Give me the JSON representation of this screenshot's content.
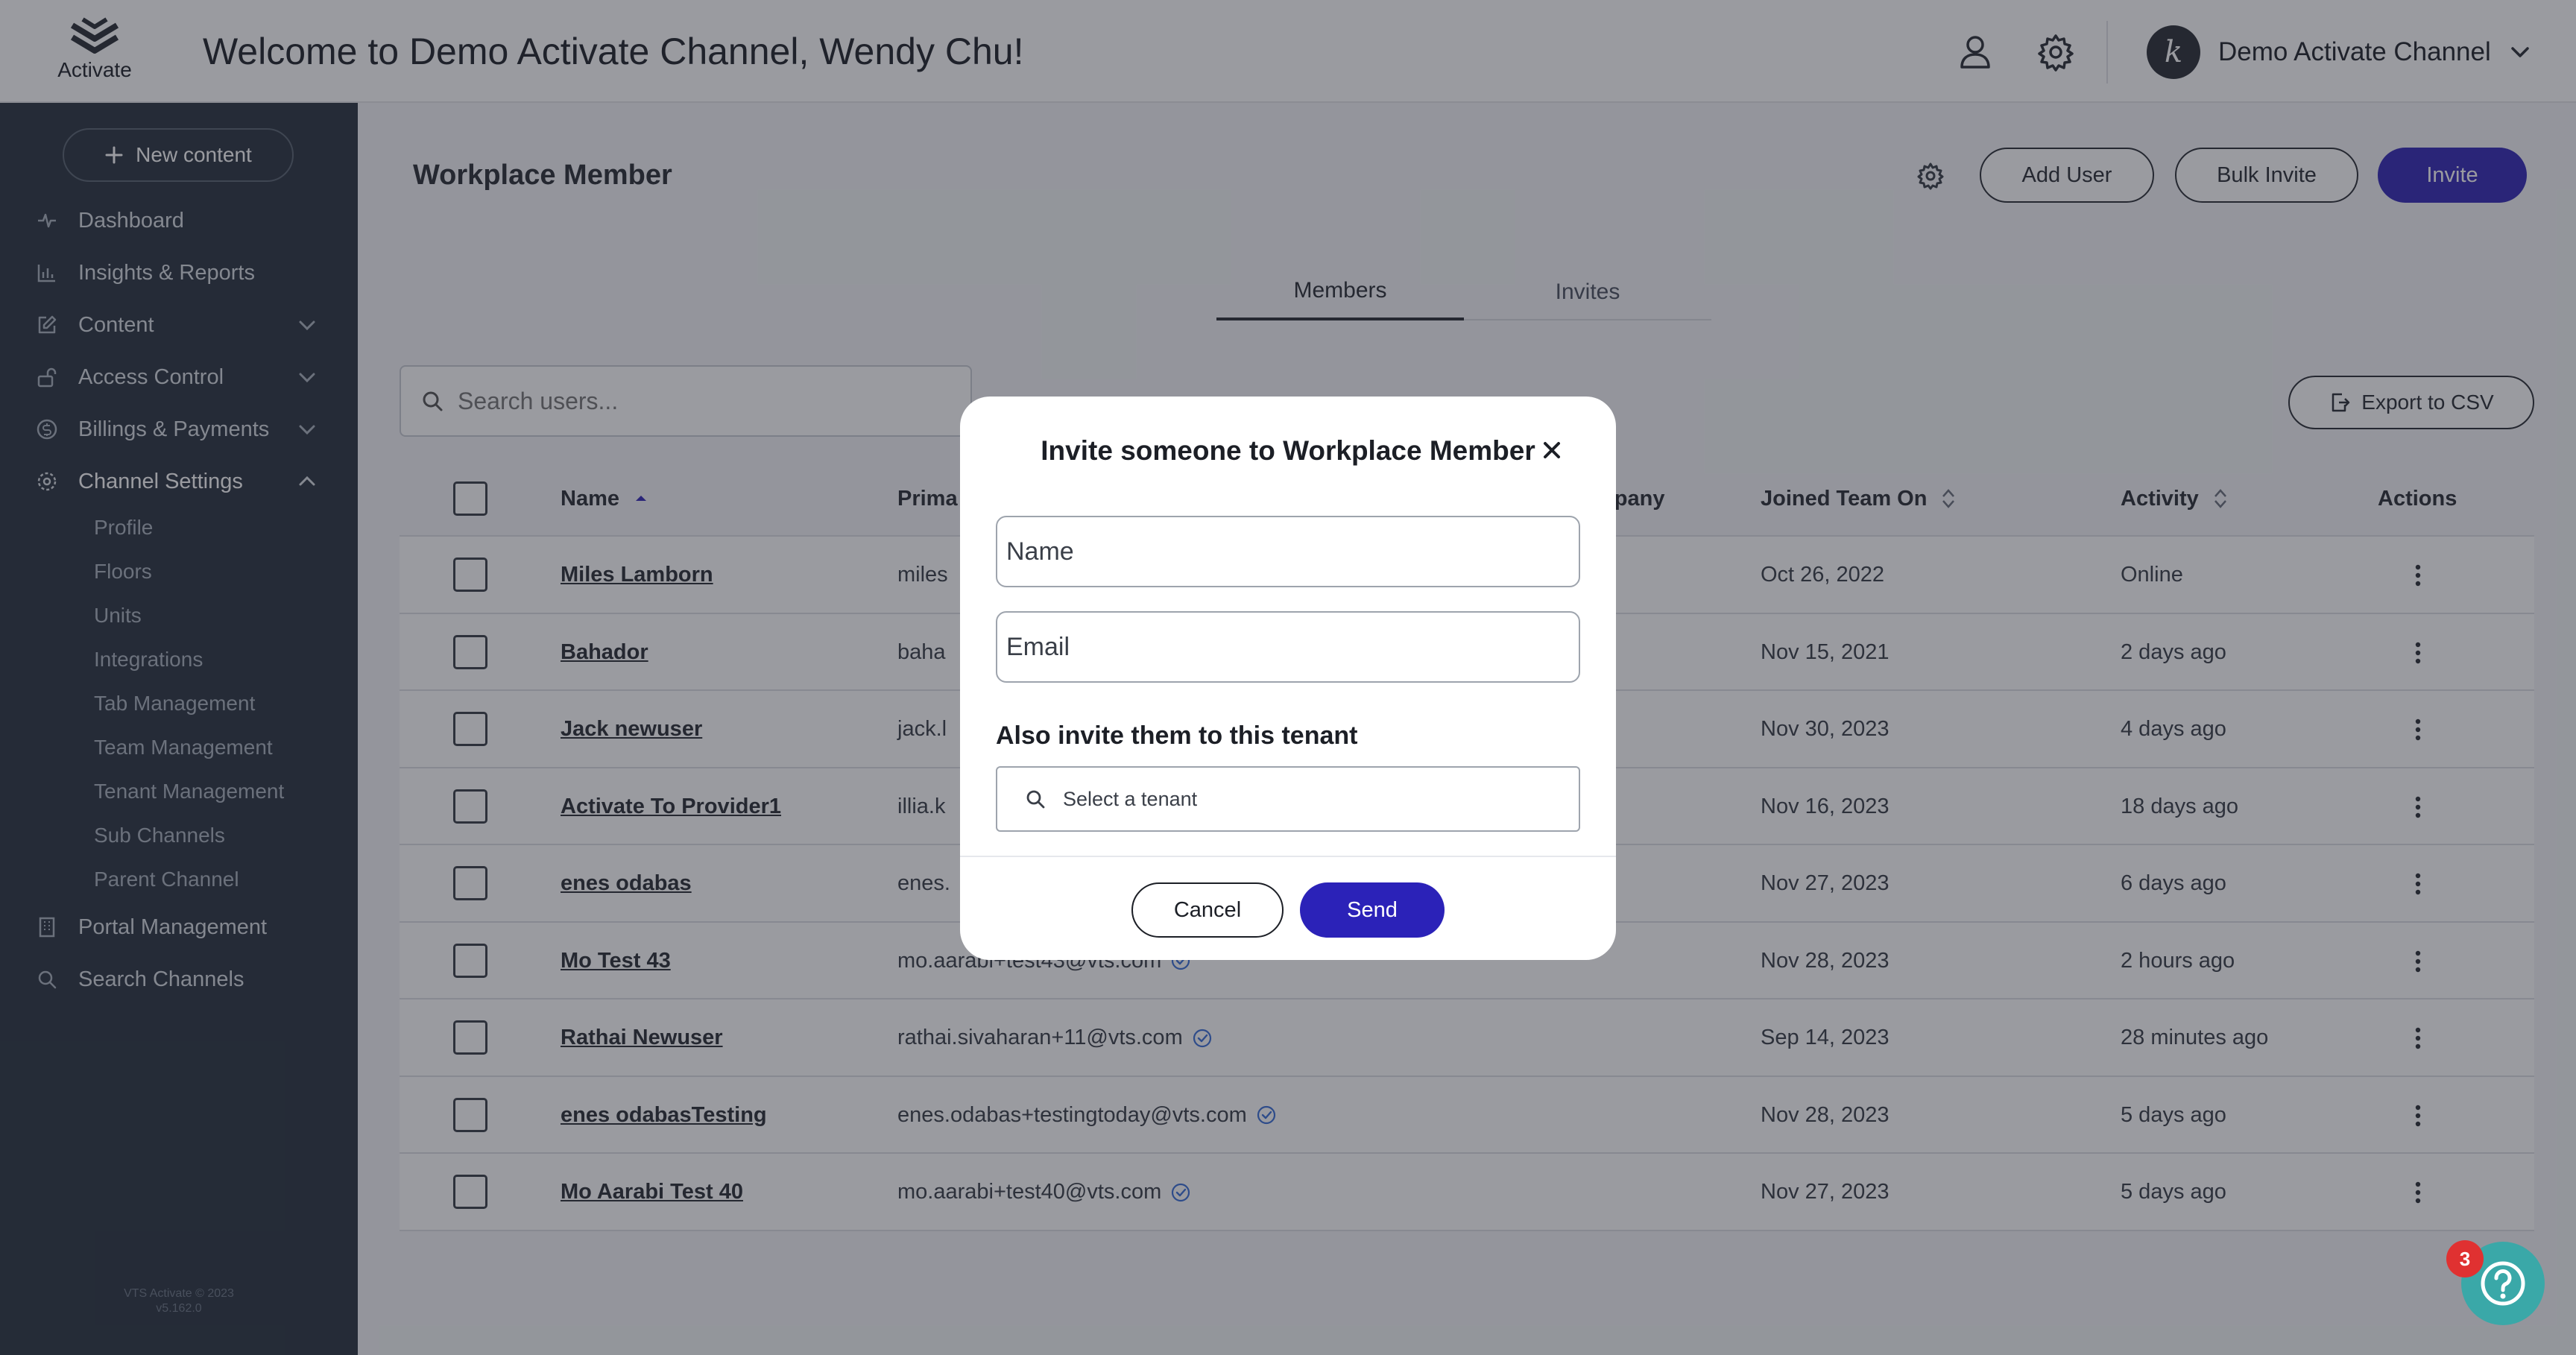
{
  "header": {
    "logo_text": "Activate",
    "welcome": "Welcome to Demo Activate Channel, Wendy Chu!",
    "user_icon": "user-icon",
    "settings_icon": "gear-icon",
    "channel": {
      "avatar_letter": "k",
      "name": "Demo Activate Channel"
    }
  },
  "sidebar": {
    "new_content_label": "New content",
    "items": [
      {
        "label": "Dashboard",
        "icon": "pulse-icon"
      },
      {
        "label": "Insights & Reports",
        "icon": "bar-chart-icon"
      },
      {
        "label": "Content",
        "icon": "edit-icon",
        "expandable": true
      },
      {
        "label": "Access Control",
        "icon": "unlock-icon",
        "expandable": true
      },
      {
        "label": "Billings & Payments",
        "icon": "dollar-icon",
        "expandable": true
      },
      {
        "label": "Channel Settings",
        "icon": "gear-icon",
        "expanded": true
      }
    ],
    "channel_settings_sub": [
      "Profile",
      "Floors",
      "Units",
      "Integrations",
      "Tab Management",
      "Team Management",
      "Tenant Management",
      "Sub Channels",
      "Parent Channel"
    ],
    "bottom_items": [
      {
        "label": "Portal Management",
        "icon": "building-icon"
      },
      {
        "label": "Search Channels",
        "icon": "search-icon"
      }
    ],
    "footer_line1": "VTS Activate © 2023",
    "footer_line2": "v5.162.0"
  },
  "main": {
    "title": "Workplace Member",
    "buttons": {
      "add_user": "Add User",
      "bulk_invite": "Bulk Invite",
      "invite": "Invite",
      "export": "Export to CSV"
    },
    "tabs": [
      "Members",
      "Invites"
    ],
    "active_tab": "Members",
    "search_placeholder": "Search users...",
    "columns": [
      "Name",
      "Prima",
      "mpany",
      "Joined Team On",
      "Activity",
      "Actions"
    ],
    "rows": [
      {
        "name": "Miles Lamborn",
        "email": "miles",
        "verified": false,
        "joined": "Oct 26, 2022",
        "activity": "Online"
      },
      {
        "name": "Bahador",
        "email": "baha",
        "verified": false,
        "joined": "Nov 15, 2021",
        "activity": "2 days ago"
      },
      {
        "name": "Jack newuser",
        "email": "jack.l",
        "verified": false,
        "joined": "Nov 30, 2023",
        "activity": "4 days ago"
      },
      {
        "name": "Activate To Provider1",
        "email": "illia.k",
        "verified": false,
        "joined": "Nov 16, 2023",
        "activity": "18 days ago"
      },
      {
        "name": "enes odabas",
        "email": "enes.",
        "verified": false,
        "joined": "Nov 27, 2023",
        "activity": "6 days ago"
      },
      {
        "name": "Mo Test 43",
        "email": "mo.aarabi+test43@vts.com",
        "verified": true,
        "joined": "Nov 28, 2023",
        "activity": "2 hours ago"
      },
      {
        "name": "Rathai Newuser",
        "email": "rathai.sivaharan+11@vts.com",
        "verified": true,
        "joined": "Sep 14, 2023",
        "activity": "28 minutes ago"
      },
      {
        "name": "enes odabasTesting",
        "email": "enes.odabas+testingtoday@vts.com",
        "verified": true,
        "joined": "Nov 28, 2023",
        "activity": "5 days ago"
      },
      {
        "name": "Mo Aarabi Test 40",
        "email": "mo.aarabi+test40@vts.com",
        "verified": true,
        "joined": "Nov 27, 2023",
        "activity": "5 days ago"
      }
    ]
  },
  "modal": {
    "title": "Invite someone to Workplace Member",
    "name_placeholder": "Name",
    "email_placeholder": "Email",
    "tenant_heading": "Also invite them to this tenant",
    "tenant_placeholder": "Select a tenant",
    "cancel_label": "Cancel",
    "send_label": "Send"
  },
  "help": {
    "badge_count": "3",
    "icon": "question-icon"
  },
  "colors": {
    "primary": "#3329b6",
    "sidebar_bg": "#2b3440",
    "help": "#3aa8a8",
    "badge": "#e03131"
  }
}
